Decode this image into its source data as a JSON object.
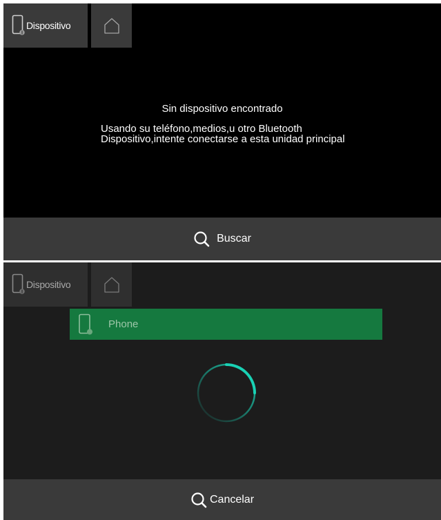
{
  "colors": {
    "accent": "#15793f",
    "spinner": "#19d1b4",
    "bar_background": "#3a3a3a"
  },
  "top_screen": {
    "tabs": {
      "device_label": "Dispositivo",
      "device_icon": "phone-device-icon",
      "home_icon": "home-icon"
    },
    "message_title": "Sin dispositivo encontrado",
    "message_body": "Usando su teléfono,medios,u otro Bluetooth Dispositivo,intente conectarse a esta unidad principal",
    "search_button_label": "Buscar",
    "search_icon": "search-icon"
  },
  "bottom_screen": {
    "tabs": {
      "device_label": "Dispositivo",
      "device_icon": "phone-device-icon",
      "home_icon": "home-icon"
    },
    "device_list": [
      {
        "name": "Phone",
        "icon": "phone-icon",
        "selected": true
      }
    ],
    "loading_indicator": "spinner",
    "cancel_button_label": "Cancelar",
    "cancel_icon": "search-icon"
  }
}
